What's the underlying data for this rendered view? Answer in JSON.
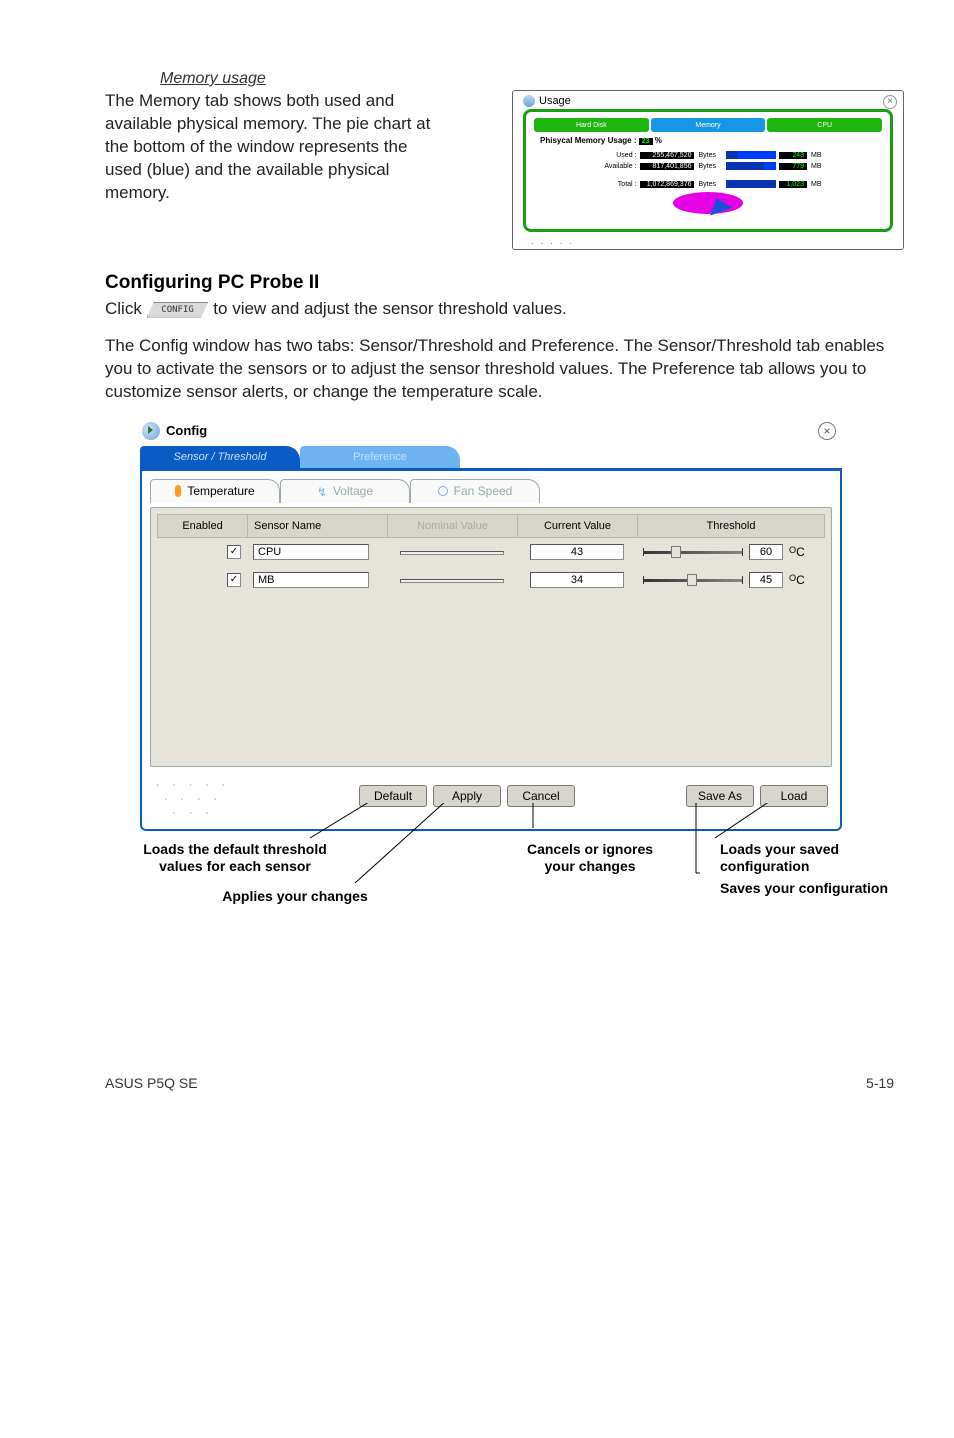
{
  "section_title": "Memory usage",
  "top_paragraph": "The Memory tab shows both used and available physical memory. The pie chart at the bottom of the window represents the used (blue) and the available physical memory.",
  "usage": {
    "window_title": "Usage",
    "tabs": {
      "hd": "Hard Disk",
      "mem": "Memory",
      "cpu": "CPU"
    },
    "heading": "Phisycal Memory Usage :",
    "heading_pct": "23",
    "heading_pct_unit": "%",
    "rows": {
      "used": {
        "label": "Used :",
        "bytes": "255,467,520",
        "unit": "Bytes",
        "mb": "243",
        "mb_unit": "MB"
      },
      "available": {
        "label": "Available :",
        "bytes": "817,401,856",
        "unit": "Bytes",
        "mb": "779",
        "mb_unit": "MB"
      },
      "total": {
        "label": "Total :",
        "bytes": "1,072,869,376",
        "unit": "Bytes",
        "mb": "1,023",
        "mb_unit": "MB"
      }
    }
  },
  "subhead": "Configuring PC Probe II",
  "click_line_pre": "Click ",
  "click_chip": "CONFIG",
  "click_line_post": " to view and adjust the sensor threshold values.",
  "para2": "The Config window has two tabs: Sensor/Threshold and Preference. The Sensor/Threshold tab enables you to activate the sensors or to adjust the sensor threshold values. The Preference tab allows you to customize sensor alerts, or change the temperature scale.",
  "config": {
    "window_title": "Config",
    "top_tabs": {
      "sensor": "Sensor / Threshold",
      "pref": "Preference"
    },
    "sub_tabs": {
      "temp": "Temperature",
      "volt": "Voltage",
      "fan": "Fan Speed"
    },
    "headers": {
      "enabled": "Enabled",
      "name": "Sensor Name",
      "nominal": "Nominal Value",
      "current": "Current Value",
      "threshold": "Threshold"
    },
    "rows": [
      {
        "checked": "✓",
        "name": "CPU",
        "nominal": "",
        "current": "43",
        "threshold_value": "60",
        "unit_sup": "O",
        "unit": "C"
      },
      {
        "checked": "✓",
        "name": "MB",
        "nominal": "",
        "current": "34",
        "threshold_value": "45",
        "unit_sup": "O",
        "unit": "C"
      }
    ],
    "buttons": {
      "default": "Default",
      "apply": "Apply",
      "cancel": "Cancel",
      "saveas": "Save As",
      "load": "Load"
    }
  },
  "annotations": {
    "left_main": "Loads the default threshold values for each sensor",
    "left_sub": "Applies your changes",
    "mid": "Cancels or ignores your changes",
    "right_main": "Loads your saved configuration",
    "right_sub": "Saves your configuration"
  },
  "footer": {
    "left": "ASUS P5Q SE",
    "right": "5-19"
  }
}
